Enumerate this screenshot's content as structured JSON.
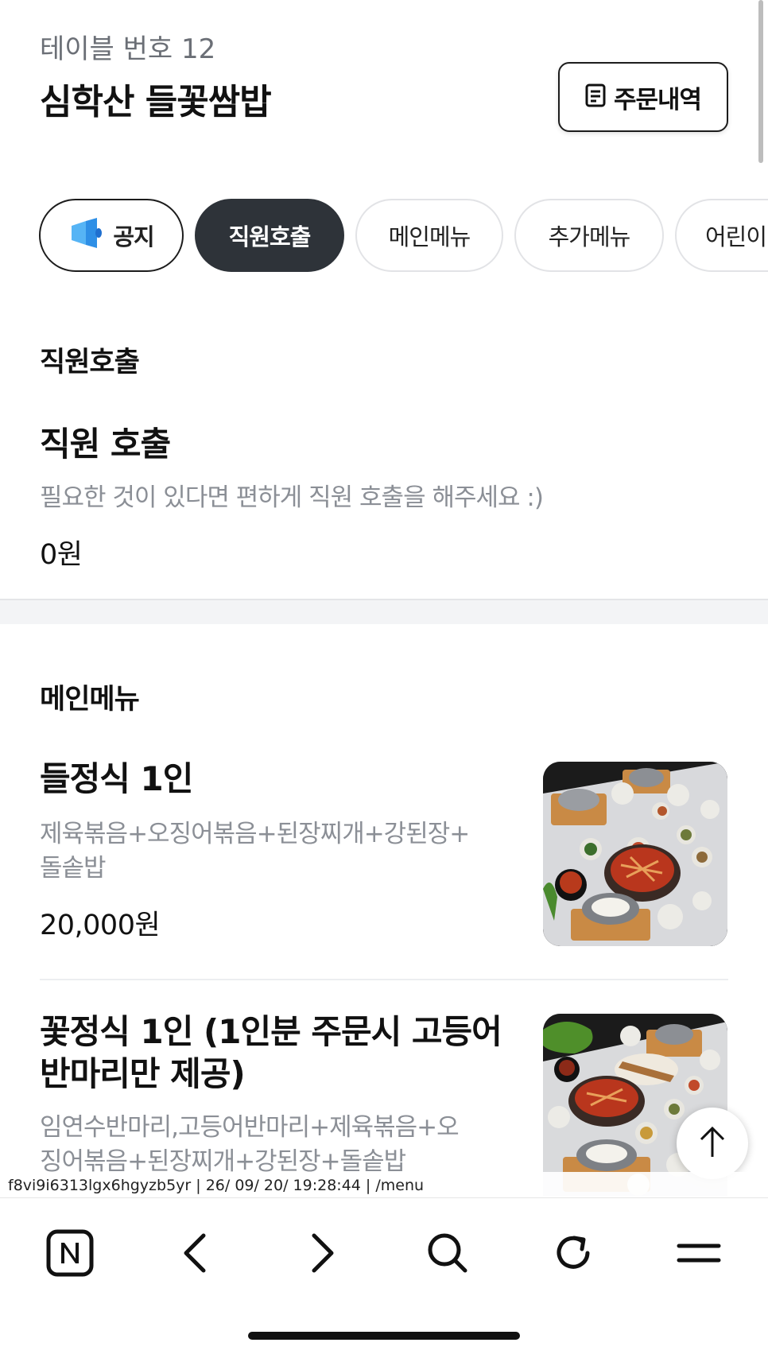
{
  "header": {
    "table_number": "테이블 번호 12",
    "store_name": "심학산 들꽃쌈밥",
    "order_history_label": "주문내역"
  },
  "tabs": [
    {
      "label": "공지",
      "icon": "megaphone-icon"
    },
    {
      "label": "직원호출",
      "active": true
    },
    {
      "label": "메인메뉴"
    },
    {
      "label": "추가메뉴"
    },
    {
      "label": "어린이"
    }
  ],
  "sections": {
    "staff_call": {
      "title": "직원호출",
      "item": {
        "name": "직원 호출",
        "description": "필요한 것이 있다면 편하게 직원 호출을 해주세요 :)",
        "price": "0원"
      }
    },
    "main_menu": {
      "title": "메인메뉴",
      "items": [
        {
          "name": "들정식 1인",
          "description_line1": "제육볶음+오징어볶음+된장찌개+강된장+",
          "description_line2": "돌솥밥",
          "price": "20,000원",
          "image": "korean-table-set-photo"
        },
        {
          "name_line1": "꽃정식 1인 (1인분 주문시 고등어",
          "name_line2": "반마리만 제공)",
          "description_line1": "임연수반마리,고등어반마리+제육볶음+오",
          "description_line2": "징어볶음+된장찌개+강된장+돌솥밥",
          "image": "korean-table-set-with-fish-photo"
        }
      ]
    }
  },
  "url_overlay": "f8vi9i6313lgx6hgyzb5yr | 26/ 09/ 20/ 19:28:44 | /menu",
  "toolbar": {
    "items": [
      "naver-home-icon",
      "back-arrow-icon",
      "forward-arrow-icon",
      "search-icon",
      "reload-icon",
      "menu-icon"
    ]
  },
  "colors": {
    "active_tab": "#2e3339",
    "notice_icon": "#3aa0f0",
    "muted_text": "#8b8f96"
  }
}
